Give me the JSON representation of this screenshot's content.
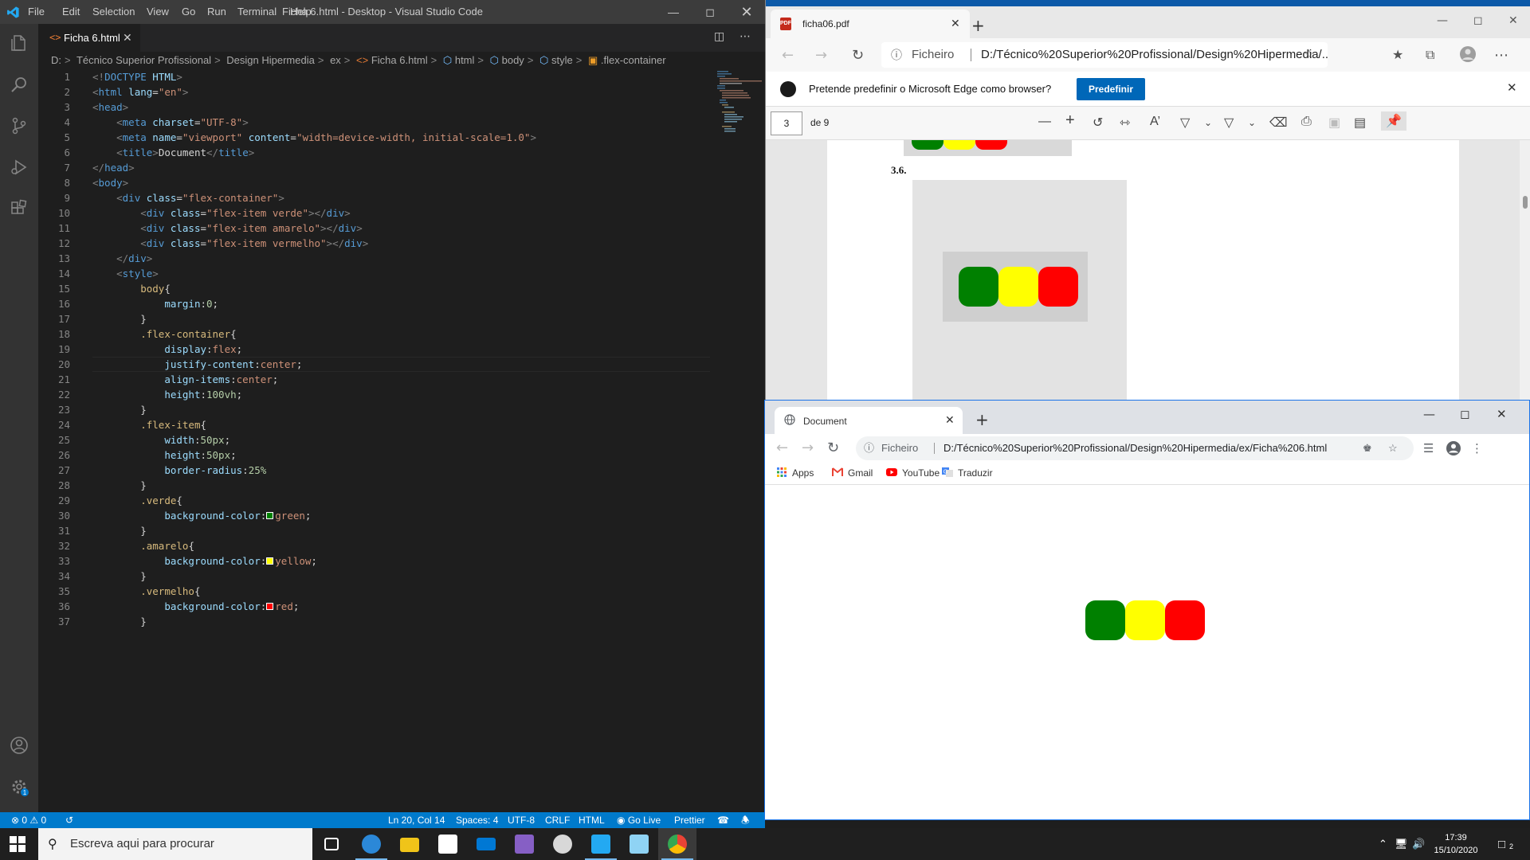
{
  "vscode": {
    "menu": [
      "File",
      "Edit",
      "Selection",
      "View",
      "Go",
      "Run",
      "Terminal",
      "Help"
    ],
    "title": "Ficha 6.html - Desktop - Visual Studio Code",
    "tab_label": "Ficha 6.html",
    "breadcrumb": [
      "D:",
      "Técnico Superior Profissional",
      "Design Hipermedia",
      "ex",
      "Ficha 6.html",
      "html",
      "body",
      "style",
      ".flex-container"
    ],
    "code_lines": [
      [
        [
          "t-punct",
          "<!"
        ],
        [
          "t-tag",
          "DOCTYPE"
        ],
        [
          "t-text",
          " "
        ],
        [
          "t-attr",
          "HTML"
        ],
        [
          "t-punct",
          ">"
        ]
      ],
      [
        [
          "t-punct",
          "<"
        ],
        [
          "t-tag",
          "html"
        ],
        [
          "t-text",
          " "
        ],
        [
          "t-attr",
          "lang"
        ],
        [
          "t-text",
          "="
        ],
        [
          "t-str",
          "\"en\""
        ],
        [
          "t-punct",
          ">"
        ]
      ],
      [
        [
          "t-punct",
          "<"
        ],
        [
          "t-tag",
          "head"
        ],
        [
          "t-punct",
          ">"
        ]
      ],
      [
        [
          "t-text",
          "    "
        ],
        [
          "t-punct",
          "<"
        ],
        [
          "t-tag",
          "meta"
        ],
        [
          "t-text",
          " "
        ],
        [
          "t-attr",
          "charset"
        ],
        [
          "t-text",
          "="
        ],
        [
          "t-str",
          "\"UTF-8\""
        ],
        [
          "t-punct",
          ">"
        ]
      ],
      [
        [
          "t-text",
          "    "
        ],
        [
          "t-punct",
          "<"
        ],
        [
          "t-tag",
          "meta"
        ],
        [
          "t-text",
          " "
        ],
        [
          "t-attr",
          "name"
        ],
        [
          "t-text",
          "="
        ],
        [
          "t-str",
          "\"viewport\""
        ],
        [
          "t-text",
          " "
        ],
        [
          "t-attr",
          "content"
        ],
        [
          "t-text",
          "="
        ],
        [
          "t-str",
          "\"width=device-width, initial-scale=1.0\""
        ],
        [
          "t-punct",
          ">"
        ]
      ],
      [
        [
          "t-text",
          "    "
        ],
        [
          "t-punct",
          "<"
        ],
        [
          "t-tag",
          "title"
        ],
        [
          "t-punct",
          ">"
        ],
        [
          "t-text",
          "Document"
        ],
        [
          "t-punct",
          "</"
        ],
        [
          "t-tag",
          "title"
        ],
        [
          "t-punct",
          ">"
        ]
      ],
      [
        [
          "t-punct",
          "</"
        ],
        [
          "t-tag",
          "head"
        ],
        [
          "t-punct",
          ">"
        ]
      ],
      [
        [
          "t-punct",
          "<"
        ],
        [
          "t-tag",
          "body"
        ],
        [
          "t-punct",
          ">"
        ]
      ],
      [
        [
          "t-text",
          "    "
        ],
        [
          "t-punct",
          "<"
        ],
        [
          "t-tag",
          "div"
        ],
        [
          "t-text",
          " "
        ],
        [
          "t-attr",
          "class"
        ],
        [
          "t-text",
          "="
        ],
        [
          "t-str",
          "\"flex-container\""
        ],
        [
          "t-punct",
          ">"
        ]
      ],
      [
        [
          "t-text",
          "        "
        ],
        [
          "t-punct",
          "<"
        ],
        [
          "t-tag",
          "div"
        ],
        [
          "t-text",
          " "
        ],
        [
          "t-attr",
          "class"
        ],
        [
          "t-text",
          "="
        ],
        [
          "t-str",
          "\"flex-item verde\""
        ],
        [
          "t-punct",
          "></"
        ],
        [
          "t-tag",
          "div"
        ],
        [
          "t-punct",
          ">"
        ]
      ],
      [
        [
          "t-text",
          "        "
        ],
        [
          "t-punct",
          "<"
        ],
        [
          "t-tag",
          "div"
        ],
        [
          "t-text",
          " "
        ],
        [
          "t-attr",
          "class"
        ],
        [
          "t-text",
          "="
        ],
        [
          "t-str",
          "\"flex-item amarelo\""
        ],
        [
          "t-punct",
          "></"
        ],
        [
          "t-tag",
          "div"
        ],
        [
          "t-punct",
          ">"
        ]
      ],
      [
        [
          "t-text",
          "        "
        ],
        [
          "t-punct",
          "<"
        ],
        [
          "t-tag",
          "div"
        ],
        [
          "t-text",
          " "
        ],
        [
          "t-attr",
          "class"
        ],
        [
          "t-text",
          "="
        ],
        [
          "t-str",
          "\"flex-item vermelho\""
        ],
        [
          "t-punct",
          "></"
        ],
        [
          "t-tag",
          "div"
        ],
        [
          "t-punct",
          ">"
        ]
      ],
      [
        [
          "t-text",
          "    "
        ],
        [
          "t-punct",
          "</"
        ],
        [
          "t-tag",
          "div"
        ],
        [
          "t-punct",
          ">"
        ]
      ],
      [
        [
          "t-text",
          "    "
        ],
        [
          "t-punct",
          "<"
        ],
        [
          "t-tag",
          "style"
        ],
        [
          "t-punct",
          ">"
        ]
      ],
      [
        [
          "t-text",
          "        "
        ],
        [
          "t-sel",
          "body"
        ],
        [
          "t-brace",
          "{"
        ]
      ],
      [
        [
          "t-text",
          "            "
        ],
        [
          "t-prop",
          "margin"
        ],
        [
          "t-text",
          ":"
        ],
        [
          "t-num",
          "0"
        ],
        [
          "t-text",
          ";"
        ]
      ],
      [
        [
          "t-text",
          "        "
        ],
        [
          "t-brace",
          "}"
        ]
      ],
      [
        [
          "t-text",
          "        "
        ],
        [
          "t-sel",
          ".flex-container"
        ],
        [
          "t-brace",
          "{"
        ]
      ],
      [
        [
          "t-text",
          "            "
        ],
        [
          "t-prop",
          "display"
        ],
        [
          "t-text",
          ":"
        ],
        [
          "t-val",
          "flex"
        ],
        [
          "t-text",
          ";"
        ]
      ],
      [
        [
          "t-text",
          "            "
        ],
        [
          "t-prop",
          "justify-content"
        ],
        [
          "t-text",
          ":"
        ],
        [
          "t-val",
          "center"
        ],
        [
          "t-text",
          ";"
        ]
      ],
      [
        [
          "t-text",
          "            "
        ],
        [
          "t-prop",
          "align-items"
        ],
        [
          "t-text",
          ":"
        ],
        [
          "t-val",
          "center"
        ],
        [
          "t-text",
          ";"
        ]
      ],
      [
        [
          "t-text",
          "            "
        ],
        [
          "t-prop",
          "height"
        ],
        [
          "t-text",
          ":"
        ],
        [
          "t-num",
          "100vh"
        ],
        [
          "t-text",
          ";"
        ]
      ],
      [
        [
          "t-text",
          "        "
        ],
        [
          "t-brace",
          "}"
        ]
      ],
      [
        [
          "t-text",
          "        "
        ],
        [
          "t-sel",
          ".flex-item"
        ],
        [
          "t-brace",
          "{"
        ]
      ],
      [
        [
          "t-text",
          "            "
        ],
        [
          "t-prop",
          "width"
        ],
        [
          "t-text",
          ":"
        ],
        [
          "t-num",
          "50px"
        ],
        [
          "t-text",
          ";"
        ]
      ],
      [
        [
          "t-text",
          "            "
        ],
        [
          "t-prop",
          "height"
        ],
        [
          "t-text",
          ":"
        ],
        [
          "t-num",
          "50px"
        ],
        [
          "t-text",
          ";"
        ]
      ],
      [
        [
          "t-text",
          "            "
        ],
        [
          "t-prop",
          "border-radius"
        ],
        [
          "t-text",
          ":"
        ],
        [
          "t-num",
          "25%"
        ]
      ],
      [
        [
          "t-text",
          "        "
        ],
        [
          "t-brace",
          "}"
        ]
      ],
      [
        [
          "t-text",
          "        "
        ],
        [
          "t-sel",
          ".verde"
        ],
        [
          "t-brace",
          "{"
        ]
      ],
      [
        [
          "t-text",
          "            "
        ],
        [
          "t-prop",
          "background-color"
        ],
        [
          "t-text",
          ":"
        ],
        [
          "swatch",
          "#008000"
        ],
        [
          "t-val",
          "green"
        ],
        [
          "t-text",
          ";"
        ]
      ],
      [
        [
          "t-text",
          "        "
        ],
        [
          "t-brace",
          "}"
        ]
      ],
      [
        [
          "t-text",
          "        "
        ],
        [
          "t-sel",
          ".amarelo"
        ],
        [
          "t-brace",
          "{"
        ]
      ],
      [
        [
          "t-text",
          "            "
        ],
        [
          "t-prop",
          "background-color"
        ],
        [
          "t-text",
          ":"
        ],
        [
          "swatch",
          "#ffff00"
        ],
        [
          "t-val",
          "yellow"
        ],
        [
          "t-text",
          ";"
        ]
      ],
      [
        [
          "t-text",
          "        "
        ],
        [
          "t-brace",
          "}"
        ]
      ],
      [
        [
          "t-text",
          "        "
        ],
        [
          "t-sel",
          ".vermelho"
        ],
        [
          "t-brace",
          "{"
        ]
      ],
      [
        [
          "t-text",
          "            "
        ],
        [
          "t-prop",
          "background-color"
        ],
        [
          "t-text",
          ":"
        ],
        [
          "swatch",
          "#ff0000"
        ],
        [
          "t-val",
          "red"
        ],
        [
          "t-text",
          ";"
        ]
      ],
      [
        [
          "t-text",
          "        "
        ],
        [
          "t-brace",
          "}"
        ]
      ]
    ],
    "status": {
      "errors": "0",
      "warnings": "0",
      "cursor": "Ln 20, Col 14",
      "spaces": "Spaces: 4",
      "encoding": "UTF-8",
      "eol": "CRLF",
      "language": "HTML",
      "golive": "Go Live",
      "prettier": "Prettier"
    }
  },
  "edge": {
    "tab_label": "ficha06.pdf",
    "url_proto": "Ficheiro",
    "url_path": "D:/Técnico%20Superior%20Profissional/Design%20Hipermedia/...",
    "infobar_message": "Pretende predefinir o Microsoft Edge como browser?",
    "infobar_button": "Predefinir",
    "page_number": "3",
    "page_of": "de 9",
    "pdf_section": "3.6."
  },
  "chrome": {
    "tab_label": "Document",
    "url_proto": "Ficheiro",
    "url_path": "D:/Técnico%20Superior%20Profissional/Design%20Hipermedia/ex/Ficha%206.html",
    "bookmarks": [
      "Apps",
      "Gmail",
      "YouTube",
      "Traduzir"
    ]
  },
  "taskbar": {
    "search_placeholder": "Escreva aqui para procurar",
    "time": "17:39",
    "date": "15/10/2020",
    "notifications": "2"
  },
  "colors": {
    "green": "#008000",
    "yellow": "#ffff00",
    "red": "#ff0000",
    "vscode_status": "#007acc"
  }
}
